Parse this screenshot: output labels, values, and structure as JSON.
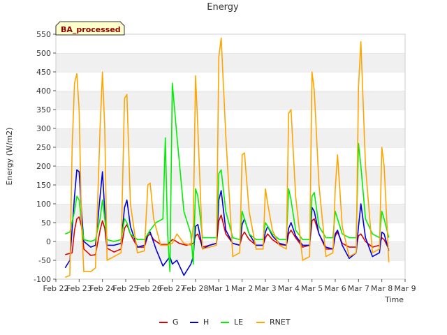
{
  "chart_data": {
    "type": "line",
    "title": "Energy",
    "xlabel": "Time",
    "ylabel": "Energy (W/m2)",
    "annotation": "BA_processed",
    "ylim": [
      -100,
      550
    ],
    "xlim": [
      0,
      15
    ],
    "grid": "horizontal-bands",
    "legend": "bottom",
    "y_ticks": [
      -100,
      -50,
      0,
      50,
      100,
      150,
      200,
      250,
      300,
      350,
      400,
      450,
      500,
      550
    ],
    "x_ticks": [
      {
        "v": 0,
        "label": "Feb 22"
      },
      {
        "v": 1,
        "label": "Feb 23"
      },
      {
        "v": 2,
        "label": "Feb 24"
      },
      {
        "v": 3,
        "label": "Feb 25"
      },
      {
        "v": 4,
        "label": "Feb 26"
      },
      {
        "v": 5,
        "label": "Feb 27"
      },
      {
        "v": 6,
        "label": "Feb 28"
      },
      {
        "v": 7,
        "label": "Mar 1"
      },
      {
        "v": 8,
        "label": "Mar 2"
      },
      {
        "v": 9,
        "label": "Mar 3"
      },
      {
        "v": 10,
        "label": "Mar 4"
      },
      {
        "v": 11,
        "label": "Mar 5"
      },
      {
        "v": 12,
        "label": "Mar 6"
      },
      {
        "v": 13,
        "label": "Mar 7"
      },
      {
        "v": 14,
        "label": "Mar 8"
      },
      {
        "v": 15,
        "label": "Mar 9"
      }
    ],
    "series": [
      {
        "name": "G",
        "color": "#dd0000",
        "x": [
          0.4,
          0.7,
          0.8,
          0.9,
          1.0,
          1.1,
          1.2,
          1.5,
          1.7,
          1.9,
          2.0,
          2.1,
          2.2,
          2.5,
          2.8,
          2.95,
          3.05,
          3.2,
          3.5,
          3.8,
          3.95,
          4.05,
          4.2,
          4.5,
          4.8,
          5.0,
          5.1,
          5.3,
          5.6,
          5.9,
          6.0,
          6.1,
          6.3,
          6.6,
          6.9,
          7.0,
          7.1,
          7.3,
          7.6,
          7.9,
          8.0,
          8.1,
          8.3,
          8.6,
          8.9,
          9.0,
          9.1,
          9.3,
          9.6,
          9.9,
          10.0,
          10.1,
          10.3,
          10.6,
          10.9,
          11.0,
          11.1,
          11.3,
          11.6,
          11.9,
          12.0,
          12.1,
          12.3,
          12.6,
          12.9,
          13.0,
          13.1,
          13.3,
          13.6,
          13.9,
          14.0,
          14.1,
          14.3
        ],
        "y": [
          -35,
          -30,
          30,
          60,
          65,
          40,
          -20,
          -37,
          -35,
          30,
          55,
          35,
          -18,
          -28,
          -20,
          35,
          45,
          20,
          -15,
          -15,
          15,
          20,
          5,
          -8,
          -8,
          5,
          3,
          -5,
          -10,
          -5,
          15,
          20,
          -15,
          -10,
          -5,
          55,
          70,
          20,
          -5,
          -10,
          15,
          25,
          5,
          -10,
          -10,
          10,
          20,
          5,
          -8,
          -10,
          20,
          30,
          10,
          -15,
          -10,
          55,
          60,
          20,
          -20,
          -20,
          15,
          25,
          -5,
          -15,
          -15,
          15,
          20,
          0,
          -15,
          -10,
          10,
          5,
          -20
        ]
      },
      {
        "name": "H",
        "color": "#0000dd",
        "x": [
          0.4,
          0.6,
          0.8,
          0.9,
          1.0,
          1.1,
          1.2,
          1.5,
          1.7,
          1.9,
          2.0,
          2.1,
          2.2,
          2.5,
          2.8,
          2.95,
          3.05,
          3.2,
          3.5,
          3.8,
          3.95,
          4.05,
          4.3,
          4.6,
          4.9,
          5.0,
          5.2,
          5.5,
          5.8,
          5.9,
          6.0,
          6.1,
          6.3,
          6.6,
          6.9,
          7.0,
          7.1,
          7.3,
          7.6,
          7.9,
          8.0,
          8.1,
          8.3,
          8.6,
          8.9,
          9.0,
          9.1,
          9.3,
          9.6,
          9.9,
          10.0,
          10.1,
          10.3,
          10.6,
          10.9,
          11.0,
          11.1,
          11.3,
          11.6,
          11.9,
          12.0,
          12.1,
          12.3,
          12.6,
          12.9,
          13.0,
          13.1,
          13.3,
          13.6,
          13.9,
          14.0,
          14.1,
          14.3
        ],
        "y": [
          -70,
          -50,
          120,
          190,
          185,
          80,
          0,
          -15,
          -10,
          120,
          185,
          80,
          -10,
          -10,
          -5,
          90,
          110,
          40,
          -15,
          -10,
          20,
          25,
          -20,
          -65,
          -40,
          -60,
          -50,
          -90,
          -60,
          -40,
          40,
          45,
          -20,
          -10,
          -5,
          110,
          135,
          30,
          -5,
          -10,
          45,
          60,
          20,
          -10,
          -10,
          25,
          40,
          15,
          -5,
          -10,
          35,
          50,
          15,
          -10,
          -10,
          90,
          80,
          20,
          -15,
          -20,
          20,
          30,
          -10,
          -45,
          -30,
          40,
          100,
          10,
          -40,
          -30,
          25,
          20,
          -25
        ]
      },
      {
        "name": "LE",
        "color": "#00ee00",
        "x": [
          0.4,
          0.6,
          0.8,
          0.9,
          1.0,
          1.1,
          1.2,
          1.5,
          1.7,
          1.9,
          2.0,
          2.1,
          2.2,
          2.5,
          2.8,
          2.95,
          3.05,
          3.2,
          3.5,
          3.8,
          3.95,
          4.05,
          4.3,
          4.6,
          4.7,
          4.8,
          4.9,
          5.0,
          5.2,
          5.5,
          5.8,
          5.9,
          6.0,
          6.1,
          6.3,
          6.6,
          6.9,
          7.0,
          7.1,
          7.3,
          7.6,
          7.9,
          8.0,
          8.1,
          8.3,
          8.6,
          8.9,
          9.0,
          9.1,
          9.3,
          9.6,
          9.9,
          10.0,
          10.1,
          10.3,
          10.6,
          10.9,
          11.0,
          11.1,
          11.3,
          11.6,
          11.9,
          12.0,
          12.1,
          12.3,
          12.6,
          12.9,
          13.0,
          13.1,
          13.3,
          13.6,
          13.9,
          14.0,
          14.1,
          14.3
        ],
        "y": [
          20,
          25,
          80,
          120,
          110,
          50,
          5,
          0,
          5,
          60,
          110,
          60,
          5,
          0,
          5,
          60,
          50,
          20,
          5,
          5,
          20,
          30,
          50,
          60,
          275,
          20,
          -80,
          420,
          280,
          80,
          20,
          -60,
          140,
          120,
          10,
          10,
          10,
          180,
          190,
          80,
          10,
          5,
          80,
          60,
          20,
          5,
          5,
          50,
          40,
          20,
          5,
          5,
          140,
          110,
          30,
          5,
          5,
          120,
          130,
          40,
          10,
          10,
          80,
          60,
          20,
          10,
          10,
          260,
          200,
          60,
          20,
          10,
          80,
          60,
          10
        ]
      },
      {
        "name": "RNET",
        "color": "#ffa500",
        "x": [
          0.4,
          0.6,
          0.7,
          0.8,
          0.9,
          1.0,
          1.1,
          1.2,
          1.5,
          1.7,
          1.9,
          2.0,
          2.1,
          2.2,
          2.5,
          2.8,
          2.95,
          3.05,
          3.2,
          3.5,
          3.8,
          3.95,
          4.05,
          4.2,
          4.5,
          4.8,
          5.0,
          5.2,
          5.5,
          5.8,
          5.9,
          6.0,
          6.1,
          6.3,
          6.6,
          6.9,
          7.0,
          7.1,
          7.3,
          7.6,
          7.9,
          8.0,
          8.1,
          8.3,
          8.6,
          8.9,
          9.0,
          9.1,
          9.3,
          9.6,
          9.9,
          10.0,
          10.1,
          10.3,
          10.6,
          10.9,
          11.0,
          11.1,
          11.3,
          11.6,
          11.9,
          12.0,
          12.1,
          12.3,
          12.6,
          12.9,
          13.0,
          13.1,
          13.3,
          13.6,
          13.9,
          14.0,
          14.1,
          14.3
        ],
        "y": [
          -95,
          -90,
          250,
          420,
          445,
          350,
          50,
          -80,
          -80,
          -70,
          300,
          450,
          300,
          -50,
          -40,
          -30,
          380,
          390,
          100,
          -30,
          -25,
          150,
          155,
          60,
          -10,
          -10,
          -5,
          20,
          -5,
          -10,
          40,
          440,
          300,
          -20,
          -15,
          -10,
          490,
          540,
          280,
          -40,
          -30,
          230,
          235,
          80,
          -20,
          -20,
          140,
          100,
          30,
          -10,
          -20,
          340,
          350,
          120,
          -50,
          -40,
          450,
          400,
          150,
          -40,
          -30,
          140,
          230,
          40,
          -40,
          -30,
          410,
          530,
          200,
          -30,
          -20,
          250,
          200,
          -55
        ]
      }
    ]
  }
}
